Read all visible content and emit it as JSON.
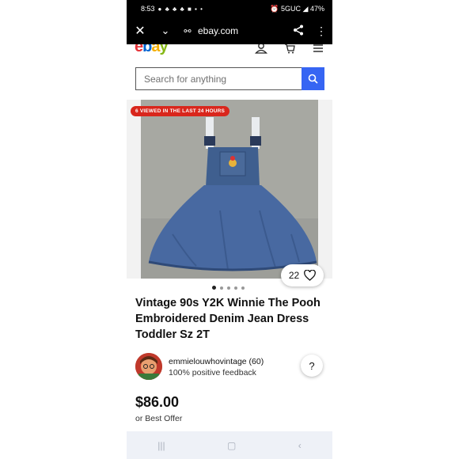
{
  "status_bar": {
    "time": "8:53",
    "notifications": "● ♣ ♣ ♣ ■ ▪ •",
    "right": "⏰ 5GUC ◢ 47%"
  },
  "browser": {
    "url": "ebay.com",
    "close_icon": "close-icon",
    "chevron_icon": "chevron-down-icon",
    "tune_icon": "site-settings-icon",
    "share_icon": "share-icon",
    "more_icon": "more-vert-icon"
  },
  "header": {
    "logo": [
      "e",
      "b",
      "a",
      "y"
    ]
  },
  "search": {
    "placeholder": "Search for anything"
  },
  "listing": {
    "viewed_badge": "6 VIEWED IN THE LAST 24 HOURS",
    "watch_count": "22",
    "title": "Vintage 90s Y2K Winnie The Pooh Embroidered Denim Jean Dress Toddler Sz 2T",
    "price": "$86.00",
    "best_offer": "or Best Offer",
    "image_count": 5,
    "active_image": 1
  },
  "seller": {
    "name": "emmielouwhovintage (60)",
    "feedback": "100% positive feedback"
  },
  "colors": {
    "accent": "#3665f3",
    "badge": "#d9261c",
    "logo_e": "#e53238",
    "logo_b": "#0064d2",
    "logo_a": "#f5af02",
    "logo_y": "#86b817"
  }
}
